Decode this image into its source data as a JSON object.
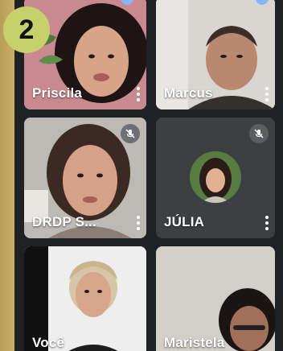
{
  "badge": {
    "number": "2"
  },
  "participants": [
    {
      "name": "Priscila",
      "active": true,
      "muted": false
    },
    {
      "name": "Marcus",
      "active": false,
      "muted": false
    },
    {
      "name": "DRDP S...",
      "active": false,
      "muted": true
    },
    {
      "name": "JÚLIA",
      "active": false,
      "muted": true,
      "avatar": true
    },
    {
      "name": "Você",
      "active": false,
      "muted": false
    },
    {
      "name": "Maristela",
      "active": false,
      "muted": false
    }
  ],
  "colors": {
    "background": "#202124",
    "tile": "#3c4043",
    "active_border": "#8ab4f8"
  },
  "icons": [
    "more-vert-icon",
    "mic-off-icon"
  ]
}
